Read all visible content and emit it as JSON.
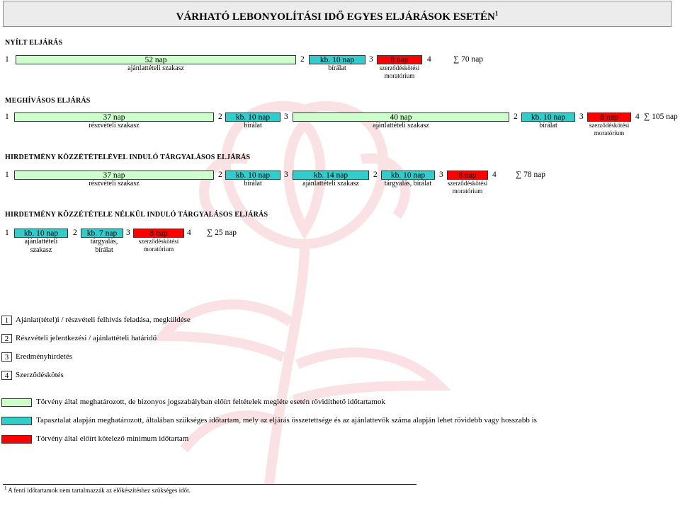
{
  "title": {
    "text": "VÁRHATÓ LEBONYOLÍTÁSI IDŐ EGYES ELJÁRÁSOK ESETÉN",
    "sup": "1"
  },
  "colors": {
    "green": "#ccffcc",
    "blue": "#33cccc",
    "red": "#ff0000"
  },
  "sections": [
    {
      "heading": "NYÍLT ELJÁRÁS",
      "nums": [
        "1",
        "2",
        "3",
        "4"
      ],
      "bars": [
        {
          "label": "52 nap",
          "sub": "ajánlattételi szakasz"
        },
        {
          "label": "kb. 10 nap",
          "sub": "bírálat"
        },
        {
          "label": "8 nap",
          "sub": "szerződéskötési moratórium"
        }
      ],
      "total": "∑ 70 nap"
    },
    {
      "heading": "MEGHÍVÁSOS ELJÁRÁS",
      "nums": [
        "1",
        "2",
        "3",
        "2",
        "3",
        "4"
      ],
      "bars": [
        {
          "label": "37 nap",
          "sub": "részvételi szakasz"
        },
        {
          "label": "kb. 10 nap",
          "sub": "bírálat"
        },
        {
          "label": "40 nap",
          "sub": "ajánlattételi szakasz"
        },
        {
          "label": "kb. 10 nap",
          "sub": "bírálat"
        },
        {
          "label": "8 nap",
          "sub": "szerződéskötési moratórium"
        }
      ],
      "total": "∑ 105 nap"
    },
    {
      "heading": "HIRDETMÉNY KÖZZÉTÉTELÉVEL INDULÓ TÁRGYALÁSOS ELJÁRÁS",
      "nums": [
        "1",
        "2",
        "3",
        "2",
        "3",
        "4"
      ],
      "bars": [
        {
          "label": "37 nap",
          "sub": "részvételi szakasz"
        },
        {
          "label": "kb. 10 nap",
          "sub": "bírálat"
        },
        {
          "label": "kb. 14 nap",
          "sub": "ajánlattételi szakasz"
        },
        {
          "label": "kb. 10 nap",
          "sub": "tárgyalás, bírálat"
        },
        {
          "label": "8 nap",
          "sub": "szerződéskötési moratórium"
        }
      ],
      "total": "∑ 78 nap"
    },
    {
      "heading": "HIRDETMÉNY KÖZZÉTÉTELE NÉLKÜL INDULÓ TÁRGYALÁSOS ELJÁRÁS",
      "nums": [
        "1",
        "2",
        "3",
        "4"
      ],
      "bars": [
        {
          "label": "kb. 10 nap",
          "sub": "ajánlattételi szakasz"
        },
        {
          "label": "kb. 7 nap",
          "sub": "tárgyalás, bírálat"
        },
        {
          "label": "8 nap",
          "sub": "szerződéskötési moratórium"
        }
      ],
      "total": "∑ 25 nap"
    }
  ],
  "legend_steps": [
    {
      "num": "1",
      "text": "Ajánlat(tétel)i / részvételi felhívás feladása, megküldése"
    },
    {
      "num": "2",
      "text": "Részvételi jelentkezési / ajánlattételi határidő"
    },
    {
      "num": "3",
      "text": "Eredményhirdetés"
    },
    {
      "num": "4",
      "text": "Szerződéskötés"
    }
  ],
  "legend_colors": [
    {
      "text": "Törvény által meghatározott, de bizonyos jogszabályban előírt feltételek megléte esetén rövidíthető időtartamok"
    },
    {
      "text": "Tapasztalat alapján meghatározott, általában szükséges időtartam, mely az eljárás összetettsége és az ajánlattevők száma alapján lehet rövidebb vagy hosszabb is"
    },
    {
      "text": "Törvény által előírt kötelező minimum időtartam"
    }
  ],
  "footnote": {
    "sup": "1",
    "text": "A fenti időtartamok nem tartalmazzák az előkészítéshez szükséges időt."
  }
}
